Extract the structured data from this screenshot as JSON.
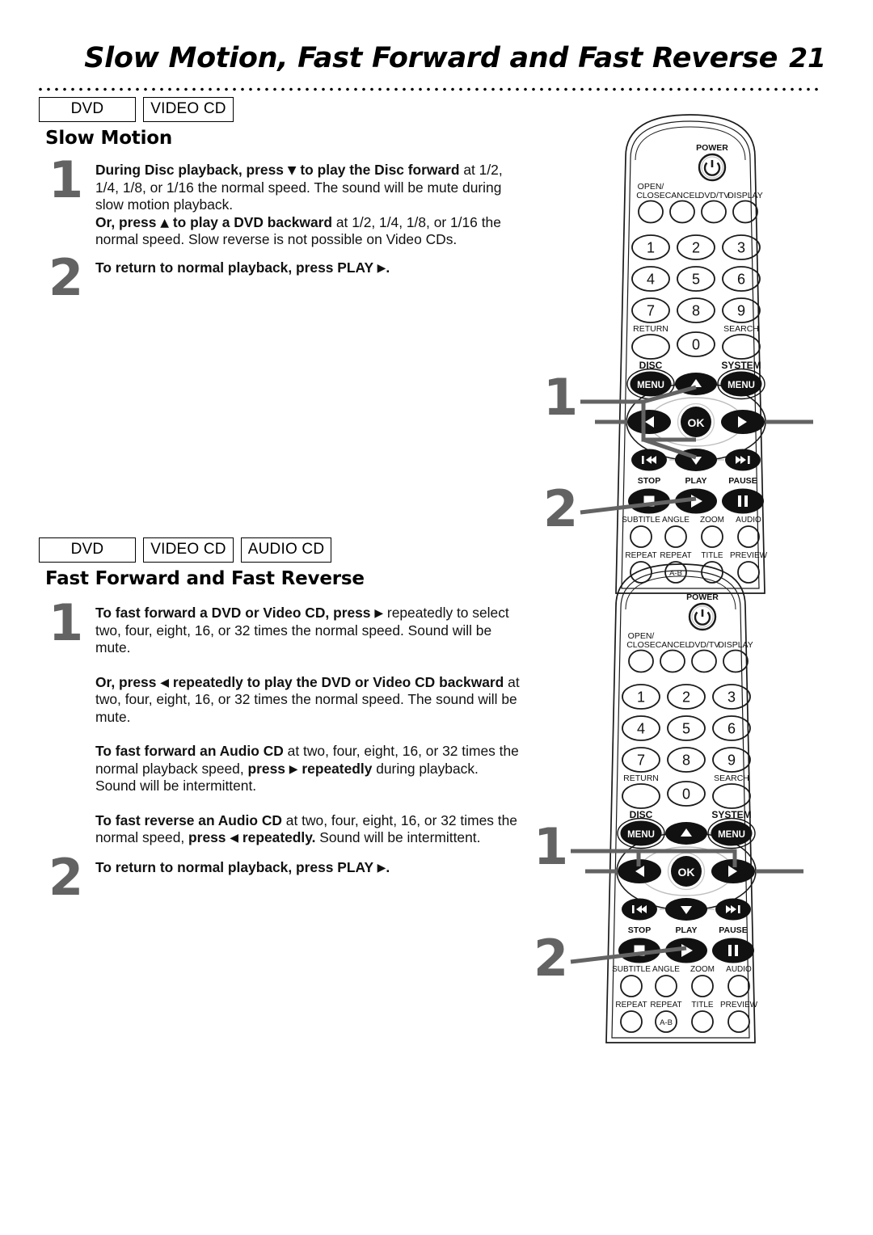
{
  "header": {
    "title": "Slow Motion, Fast Forward and Fast Reverse",
    "page_number": "21"
  },
  "sections": [
    {
      "badges": [
        "DVD",
        "VIDEO CD"
      ],
      "heading": "Slow Motion",
      "steps": [
        {
          "number": "1",
          "paragraphs": [
            "<b>During Disc playback, press <span class=\"tri\">▼</span> to play the Disc forward</b> at 1/2, 1/4, 1/8, or 1/16 the normal speed. The sound will be mute during slow motion playback.<br><b>Or, press <span class=\"tri\">▲</span> to play a DVD backward</b> at 1/2, 1/4, 1/8, or 1/16 the normal speed. Slow reverse is not possible on Video CDs."
          ]
        },
        {
          "number": "2",
          "paragraphs": [
            "<b>To return to normal playback, press PLAY <span class=\"tri\">▶</span>.</b>"
          ]
        }
      ],
      "callouts": [
        "1",
        "2"
      ]
    },
    {
      "badges": [
        "DVD",
        "VIDEO CD",
        "AUDIO CD"
      ],
      "heading": "Fast Forward and Fast Reverse",
      "steps": [
        {
          "number": "1",
          "paragraphs": [
            "<b>To fast forward a DVD or Video CD, press <span class=\"tri\">▶</span></b> repeatedly to select two, four, eight, 16, or 32 times the normal speed. Sound will be mute.",
            "<b>Or, press <span class=\"tri\">◀</span> repeatedly to play the DVD or Video CD backward</b> at two, four, eight, 16, or 32 times the normal speed. The sound will be mute.",
            "<b>To fast forward an Audio CD</b> at two, four, eight, 16, or 32 times the normal playback speed, <b>press <span class=\"tri\">▶</span> repeatedly</b> during playback. Sound will be intermittent.",
            "<b>To fast reverse an Audio CD</b> at two, four, eight, 16, or 32 times the normal speed, <b>press <span class=\"tri\">◀</span> repeatedly.</b> Sound will be intermittent."
          ]
        },
        {
          "number": "2",
          "paragraphs": [
            "<b>To return to normal playback, press PLAY <span class=\"tri\">▶</span>.</b>"
          ]
        }
      ],
      "callouts": [
        "1",
        "2"
      ]
    }
  ],
  "remote": {
    "power_label": "POWER",
    "top_row": [
      "OPEN/\nCLOSE",
      "CANCEL",
      "DVD/TV",
      "DISPLAY"
    ],
    "keypad": [
      "1",
      "2",
      "3",
      "4",
      "5",
      "6",
      "7",
      "8",
      "9"
    ],
    "zero": "0",
    "return_label": "RETURN",
    "search_label": "SEARCH",
    "disc_label": "DISC",
    "system_label": "SYSTEM",
    "menu_label": "MENU",
    "ok_label": "OK",
    "stop_label": "STOP",
    "play_label": "PLAY",
    "pause_label": "PAUSE",
    "fn_row1": [
      "SUBTITLE",
      "ANGLE",
      "ZOOM",
      "AUDIO"
    ],
    "fn_row2": [
      "REPEAT",
      "REPEAT",
      "TITLE",
      "PREVIEW"
    ],
    "repeat_ab": "A-B"
  },
  "colors": {
    "step_number": "#636363",
    "text": "#111111",
    "rule": "#000000"
  }
}
